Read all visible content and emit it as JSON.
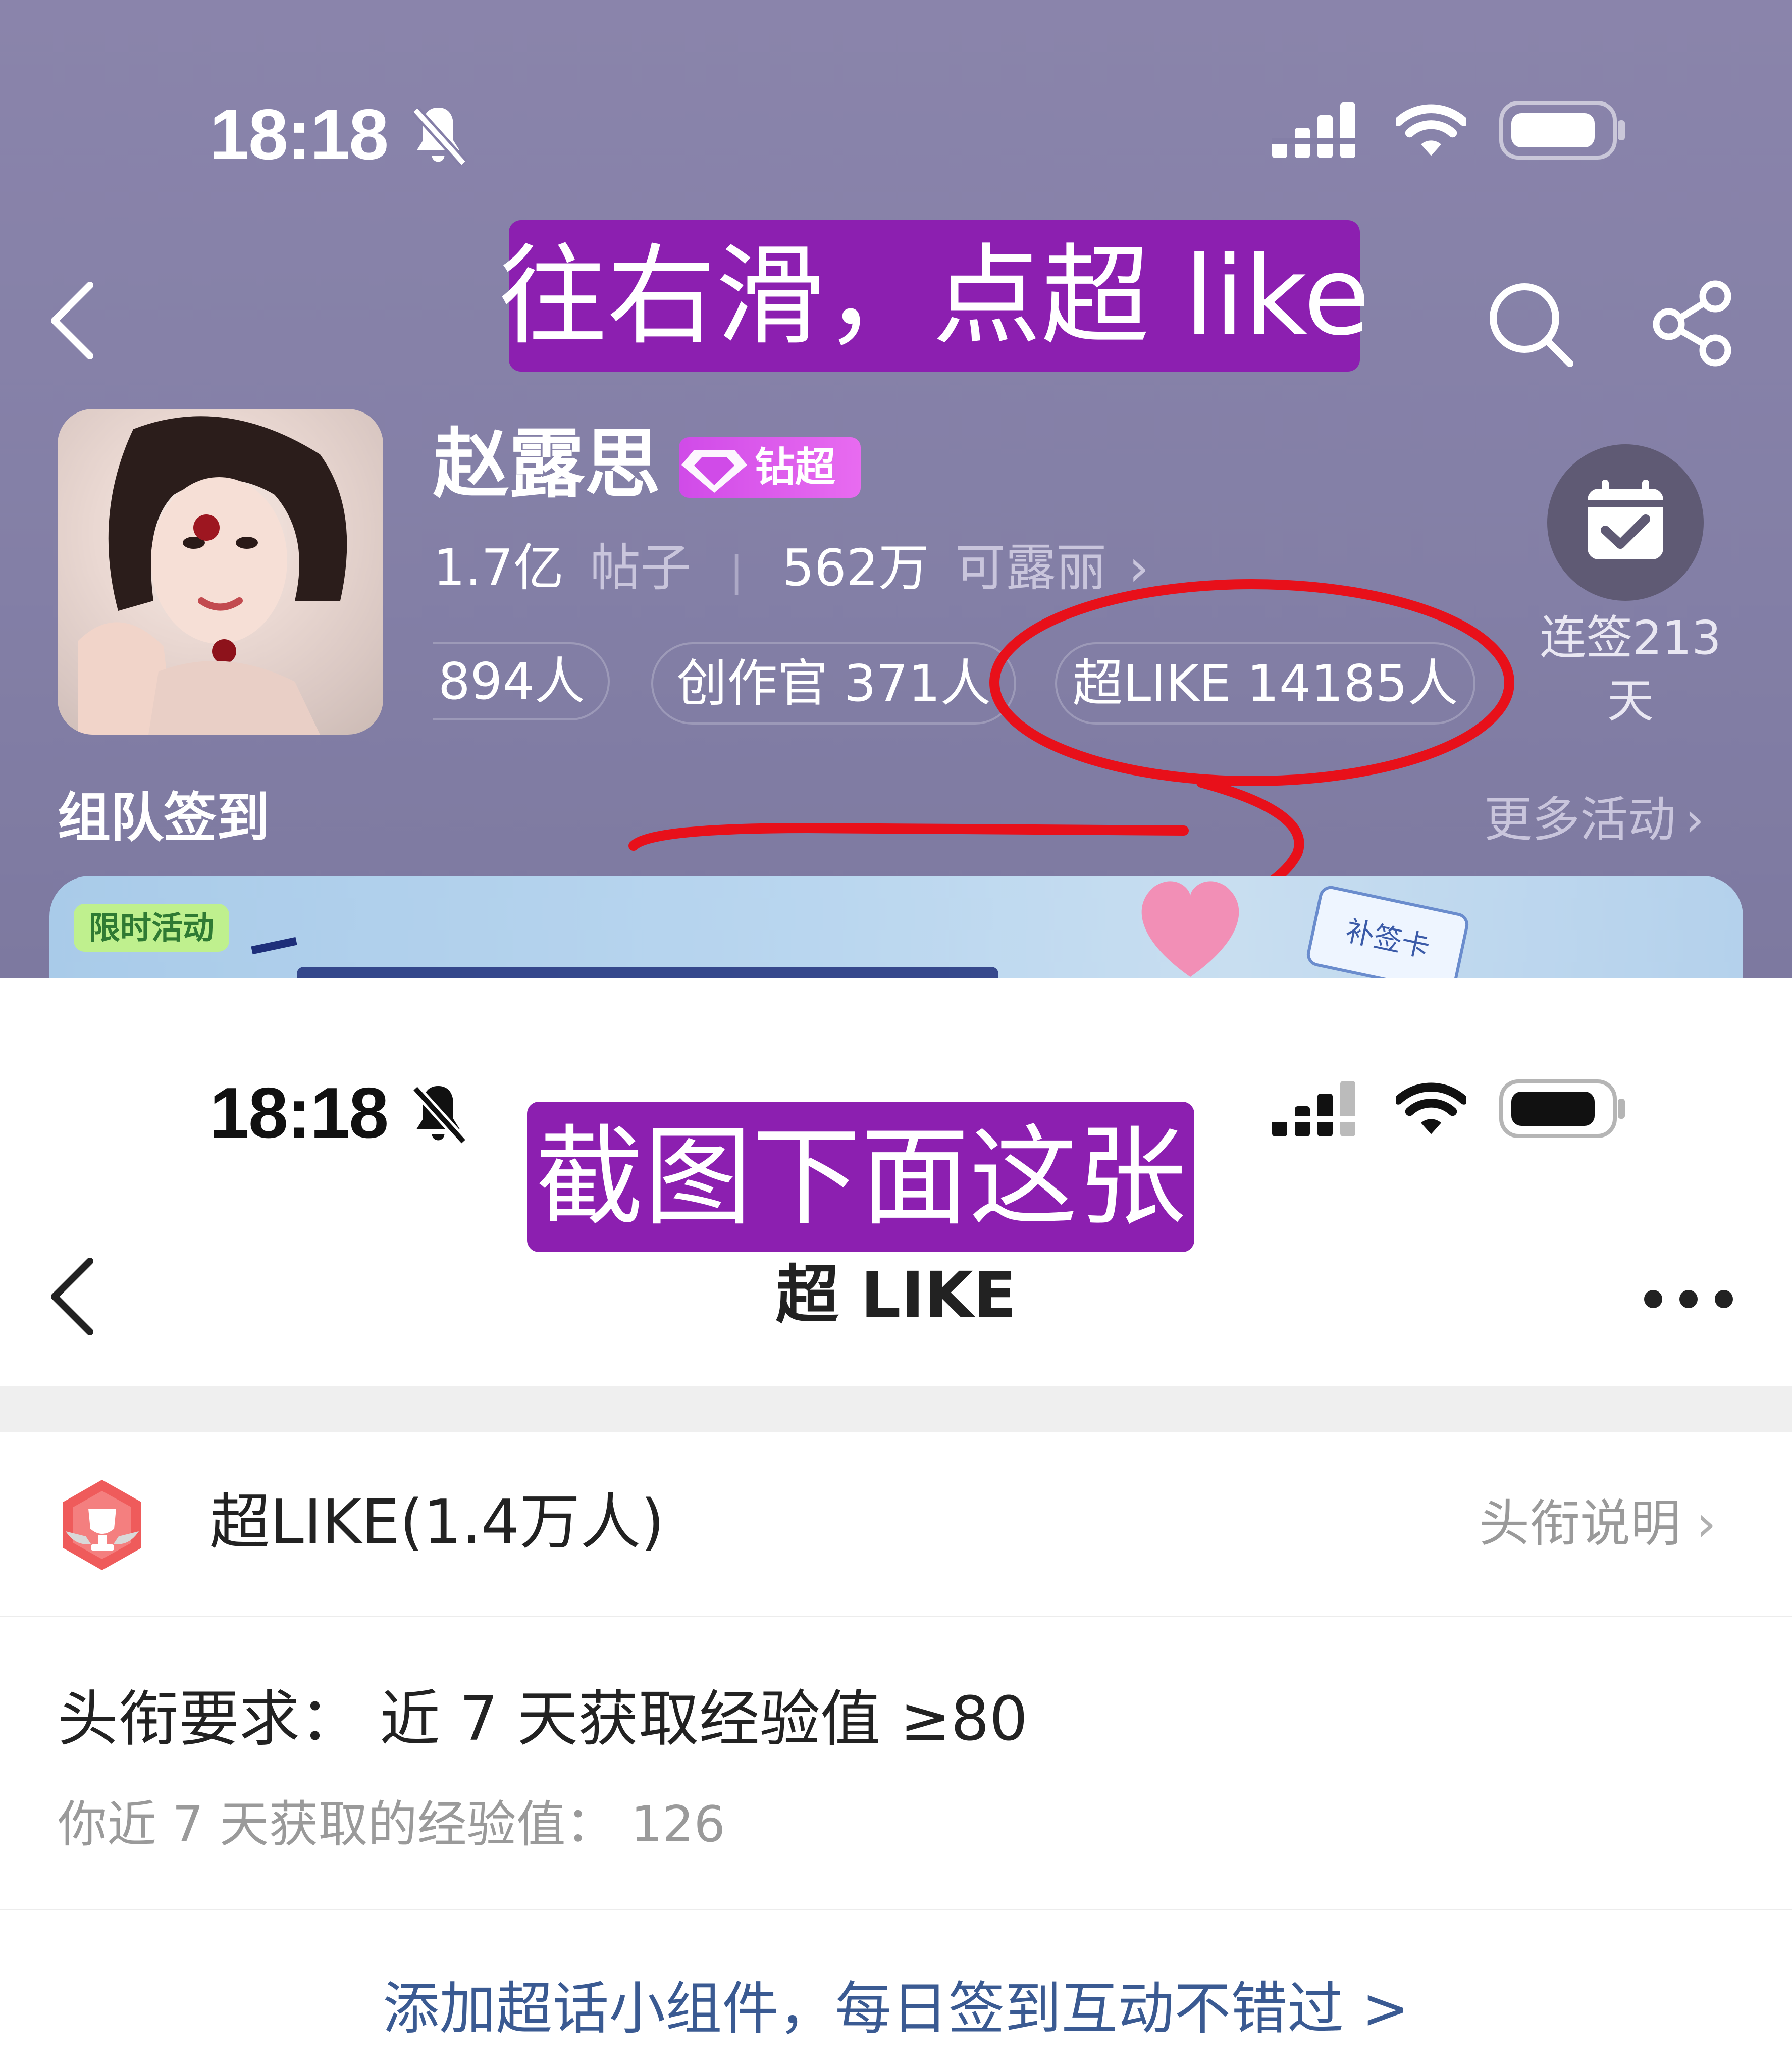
{
  "top": {
    "status": {
      "time": "18:18"
    },
    "annotation": "往右滑，点超 like",
    "profile": {
      "name": "赵露思",
      "badge_label": "钻超",
      "posts_count": "1.7亿",
      "posts_label": "帖子",
      "fans_count": "562万",
      "fans_label": "可露丽"
    },
    "pills": [
      {
        "label": "894人"
      },
      {
        "label": "创作官 371人"
      },
      {
        "label": "超LIKE 14185人"
      }
    ],
    "checkin": {
      "label_line1": "连签213",
      "label_line2": "天"
    },
    "section_title": "组队签到",
    "more_activities": "更多活动",
    "banner": {
      "tag": "限时活动",
      "card": "补签卡"
    }
  },
  "bottom": {
    "status": {
      "time": "18:18"
    },
    "annotation": "截图下面这张",
    "nav": {
      "title": "超 LIKE"
    },
    "title_row": {
      "title": "超LIKE(1.4万人)",
      "link": "头衔说明"
    },
    "requirement": {
      "text": "头衔要求：  近 7 天获取经验值 ≥80",
      "sub": "你近 7 天获取的经验值：  126"
    },
    "widget_link": "添加超话小组件，每日签到互动不错过 >"
  },
  "colors": {
    "annotation_bg": "#8c1fb0",
    "top_bg": "#847fa7",
    "red_mark": "#e8101a",
    "link_blue": "#3a5a92"
  },
  "icons": [
    "back-icon",
    "search-icon",
    "share-icon",
    "calendar-check-icon",
    "diamond-icon",
    "bell-off-icon",
    "signal-icon",
    "wifi-icon",
    "battery-icon",
    "trophy-badge-icon",
    "more-icon",
    "chevron-right-icon"
  ]
}
